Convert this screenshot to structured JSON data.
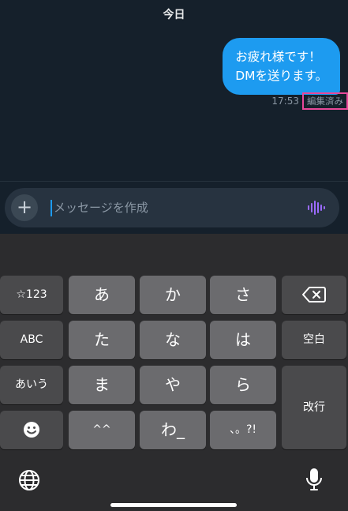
{
  "chat": {
    "date_label": "今日",
    "message": {
      "line1": "お疲れ様です！",
      "line2": "DMを送ります。",
      "time": "17:53",
      "edited_label": "編集済み"
    }
  },
  "composer": {
    "plus_label": "+",
    "placeholder": "メッセージを作成",
    "voice_icon": "voice-wave-icon",
    "accent_color": "#9b6bff"
  },
  "keyboard": {
    "rows": [
      [
        "☆123",
        "あ",
        "か",
        "さ",
        "⌫"
      ],
      [
        "ABC",
        "た",
        "な",
        "は",
        "空白"
      ],
      [
        "あいう",
        "ま",
        "や",
        "ら",
        "改行"
      ],
      [
        "☺",
        "^^",
        "わ_",
        "、。?!"
      ]
    ],
    "keys": {
      "k_123": "☆123",
      "k_a": "あ",
      "k_ka": "か",
      "k_sa": "さ",
      "k_abc": "ABC",
      "k_ta": "た",
      "k_na": "な",
      "k_ha": "は",
      "k_space": "空白",
      "k_aiu": "あいう",
      "k_ma": "ま",
      "k_ya": "や",
      "k_ra": "ら",
      "k_enter": "改行",
      "k_caret": "^^",
      "k_wa": "わ_",
      "k_punct": "、。?!"
    }
  }
}
